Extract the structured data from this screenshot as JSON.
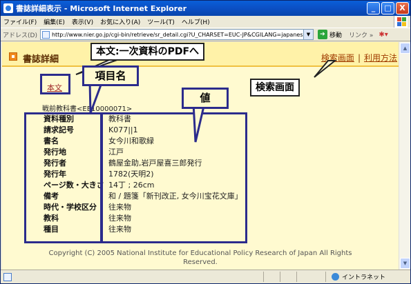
{
  "window": {
    "title": "書誌詳細表示 - Microsoft Internet Explorer",
    "buttons": {
      "minimize": "_",
      "maximize": "□",
      "close": "X"
    }
  },
  "menubar": {
    "items": [
      "ファイル(F)",
      "編集(E)",
      "表示(V)",
      "お気に入り(A)",
      "ツール(T)",
      "ヘルプ(H)"
    ]
  },
  "addressbar": {
    "label": "アドレス(D)",
    "url": "http://www.nier.go.jp/cgi-bin/retrieve/sr_detail.cgi?U_CHARSET=EUC-JP&CGILANG=japanese&ID=E",
    "go_label": "移動",
    "links_label": "リンク »"
  },
  "header": {
    "title": "書誌詳細",
    "nav": {
      "search": "検索画面",
      "separator": "|",
      "usage": "利用方法"
    }
  },
  "record": {
    "fulltext_link": "本文",
    "id_line": "戦前教科書<EE10000071>",
    "rows": [
      {
        "key": "資料種別",
        "value": "教科書"
      },
      {
        "key": "請求記号",
        "value": "K077||1"
      },
      {
        "key": "書名",
        "value": "女今川和歌緑"
      },
      {
        "key": "発行地",
        "value": "江戸"
      },
      {
        "key": "発行者",
        "value": "鶴屋金助,岩戸屋喜三郎発行"
      },
      {
        "key": "発行年",
        "value": "1782(天明2)"
      },
      {
        "key": "ページ数・大きさ",
        "value": "14丁 ; 26cm"
      },
      {
        "key": "備考",
        "value": "和 / 題箋「新刊改正, 女今川宝花文庫」"
      },
      {
        "key": "時代・学校区分",
        "value": "往来物"
      },
      {
        "key": "教科",
        "value": "往来物"
      },
      {
        "key": "種目",
        "value": "往来物"
      }
    ]
  },
  "footer": {
    "line1": "Copyright (C) 2005 National Institute for Educational Policy Research of Japan All Rights",
    "line2": "Reserved."
  },
  "statusbar": {
    "zone": "イントラネット"
  },
  "annotations": {
    "pdf_callout": "本文:一次資料のPDFへ",
    "search_callout": "検索画面",
    "item_name_label": "項目名",
    "value_label": "値"
  }
}
